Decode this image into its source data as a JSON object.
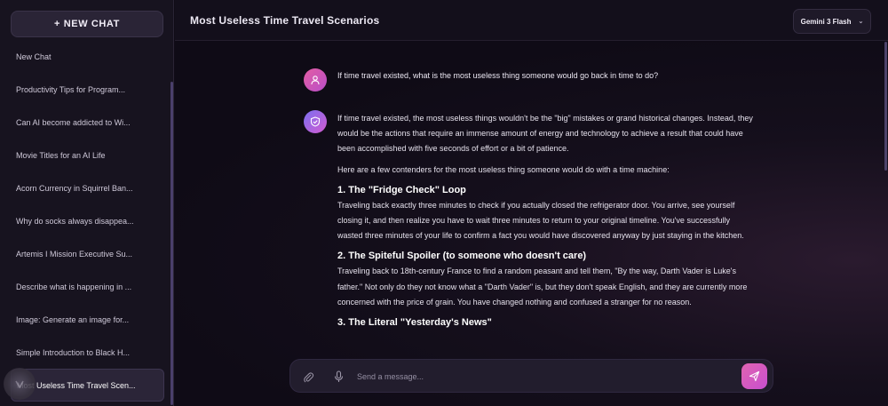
{
  "sidebar": {
    "new_chat_label": "+ NEW CHAT",
    "items": [
      {
        "label": "New Chat"
      },
      {
        "label": "Productivity Tips for Program..."
      },
      {
        "label": "Can AI become addicted to Wi..."
      },
      {
        "label": "Movie Titles for an AI Life"
      },
      {
        "label": "Acorn Currency in Squirrel Ban..."
      },
      {
        "label": "Why do socks always disappea..."
      },
      {
        "label": "Artemis I Mission Executive Su..."
      },
      {
        "label": "Describe what is happening in ..."
      },
      {
        "label": "Image: Generate an image for..."
      },
      {
        "label": "Simple Introduction to Black H..."
      },
      {
        "label": "Most Useless Time Travel Scen..."
      }
    ],
    "active_index": 10
  },
  "header": {
    "title": "Most Useless Time Travel Scenarios",
    "model": "Gemini 3 Flash"
  },
  "conversation": {
    "user_message": "If time travel existed, what is the most useless thing someone would go back in time to do?",
    "ai_intro": "If time travel existed, the most useless things wouldn't be the \"big\" mistakes or grand historical changes. Instead, they would be the actions that require an immense amount of energy and technology to achieve a result that could have been accomplished with five seconds of effort or a bit of patience.",
    "ai_lead": "Here are a few contenders for the most useless thing someone would do with a time machine:",
    "sections": [
      {
        "heading": "1. The \"Fridge Check\" Loop",
        "body": "Traveling back exactly three minutes to check if you actually closed the refrigerator door. You arrive, see yourself closing it, and then realize you have to wait three minutes to return to your original timeline. You've successfully wasted three minutes of your life to confirm a fact you would have discovered anyway by just staying in the kitchen."
      },
      {
        "heading": "2. The Spiteful Spoiler (to someone who doesn't care)",
        "body": "Traveling back to 18th-century France to find a random peasant and tell them, \"By the way, Darth Vader is Luke's father.\" Not only do they not know what a \"Darth Vader\" is, but they don't speak English, and they are currently more concerned with the price of grain. You have changed nothing and confused a stranger for no reason."
      },
      {
        "heading": "3. The Literal \"Yesterday's News\"",
        "body": ""
      }
    ]
  },
  "composer": {
    "placeholder": "Send a message..."
  },
  "colors": {
    "accent_pink": "#e064b0",
    "accent_purple": "#7b6ff0",
    "background": "#0f0b16"
  },
  "icons": {
    "attach": "paperclip-icon",
    "mic": "microphone-icon",
    "send": "send-icon",
    "user": "user-icon",
    "ai": "shield-icon"
  }
}
